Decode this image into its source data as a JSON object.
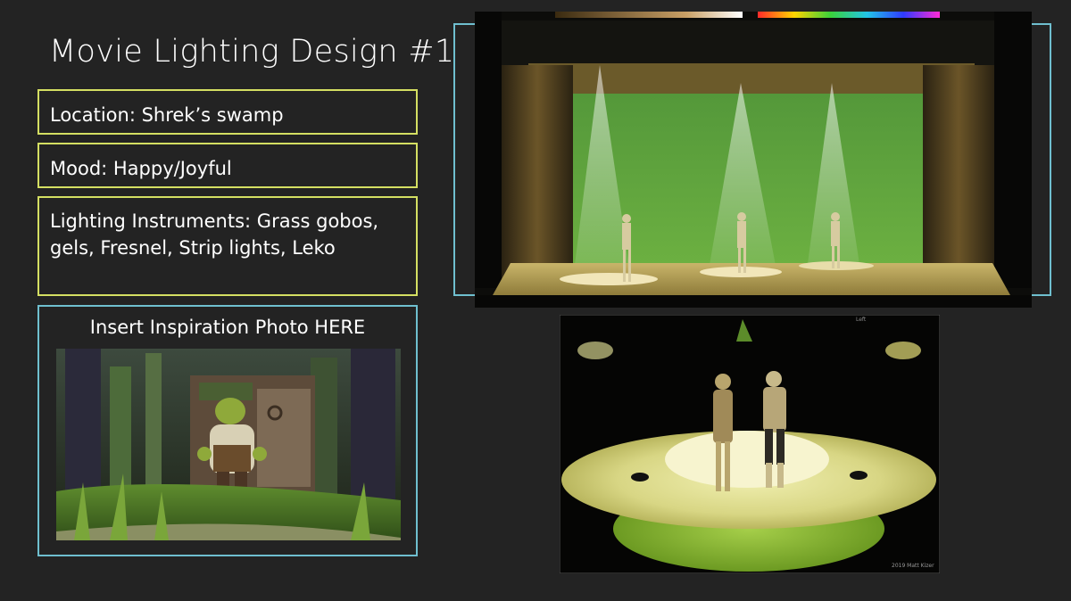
{
  "slide": {
    "title": "Movie Lighting Design #1",
    "location": "Location: Shrek’s swamp",
    "mood": "Mood: Happy/Joyful",
    "instruments": "Lighting Instruments: Grass gobos, gels, Fresnel, Strip lights, Leko",
    "inspiration_caption": "Insert Inspiration Photo HERE"
  },
  "images": {
    "inspiration": "shrek-swamp-outhouse-photo",
    "stage_render": "green-stage-three-spotlights-render",
    "spotlight_render": "two-figures-green-yellow-spotlight-render",
    "spotlight_watermark": "2019 Matt Kizer",
    "spotlight_corner_label": "Left"
  },
  "colors": {
    "background": "#232323",
    "text_box_border": "#d4df62",
    "photo_border": "#6fbfcf",
    "stage_green": "#62a63c"
  }
}
